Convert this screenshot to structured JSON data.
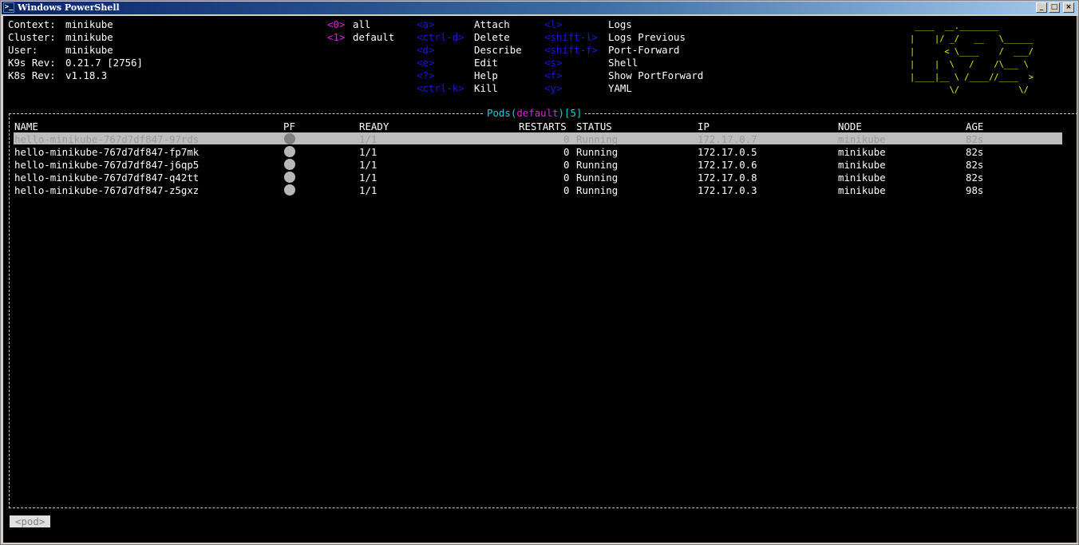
{
  "window": {
    "title": "Windows PowerShell",
    "icon": "powershell-icon",
    "controls": {
      "minimize": "_",
      "maximize": "□",
      "close": "×"
    }
  },
  "info": [
    {
      "label": "Context:",
      "value": "minikube"
    },
    {
      "label": "Cluster:",
      "value": "minikube"
    },
    {
      "label": "User:",
      "value": "minikube"
    },
    {
      "label": "K9s Rev:",
      "value": "0.21.7 [2756]"
    },
    {
      "label": "K8s Rev:",
      "value": "v1.18.3"
    }
  ],
  "namespaces": [
    {
      "key": "<0>",
      "label": "all"
    },
    {
      "key": "<1>",
      "label": "default"
    }
  ],
  "shortcuts_col1": [
    {
      "key": "<a>",
      "label": "Attach"
    },
    {
      "key": "<ctrl-d>",
      "label": "Delete"
    },
    {
      "key": "<d>",
      "label": "Describe"
    },
    {
      "key": "<e>",
      "label": "Edit"
    },
    {
      "key": "<?>",
      "label": "Help"
    },
    {
      "key": "<ctrl-k>",
      "label": "Kill"
    }
  ],
  "shortcuts_col2": [
    {
      "key": "<l>",
      "label": "Logs"
    },
    {
      "key": "<shift-l>",
      "label": "Logs Previous"
    },
    {
      "key": "<shift-f>",
      "label": "Port-Forward"
    },
    {
      "key": "<s>",
      "label": "Shell"
    },
    {
      "key": "<f>",
      "label": "Show PortForward"
    },
    {
      "key": "<y>",
      "label": "YAML"
    }
  ],
  "logo": [
    " ____  __.________       ",
    "|    |/ _/   __   \\______",
    "|      < \\____    /  ___/",
    "|    |  \\   /    /\\___ \\ ",
    "|____|__ \\ /____//____  >",
    "        \\/            \\/ "
  ],
  "table": {
    "title": {
      "resource": "Pods",
      "open": "(",
      "namespace": "default",
      "close": ")",
      "count": "[5]"
    },
    "columns": [
      "NAME",
      "PF",
      "READY",
      "RESTARTS",
      "STATUS",
      "IP",
      "NODE",
      "AGE"
    ],
    "rows": [
      {
        "name": "hello-minikube-767d7df847-97rds",
        "ready": "1/1",
        "restarts": "0",
        "status": "Running",
        "ip": "172.17.0.7",
        "node": "minikube",
        "age": "82s",
        "selected": true
      },
      {
        "name": "hello-minikube-767d7df847-fp7mk",
        "ready": "1/1",
        "restarts": "0",
        "status": "Running",
        "ip": "172.17.0.5",
        "node": "minikube",
        "age": "82s"
      },
      {
        "name": "hello-minikube-767d7df847-j6qp5",
        "ready": "1/1",
        "restarts": "0",
        "status": "Running",
        "ip": "172.17.0.6",
        "node": "minikube",
        "age": "82s"
      },
      {
        "name": "hello-minikube-767d7df847-q42tt",
        "ready": "1/1",
        "restarts": "0",
        "status": "Running",
        "ip": "172.17.0.8",
        "node": "minikube",
        "age": "82s"
      },
      {
        "name": "hello-minikube-767d7df847-z5gxz",
        "ready": "1/1",
        "restarts": "0",
        "status": "Running",
        "ip": "172.17.0.3",
        "node": "minikube",
        "age": "98s"
      }
    ]
  },
  "breadcrumb": "<pod>",
  "colors": {
    "terminal_bg": "#000000",
    "key_namespace": "#e01ee0",
    "key_shortcut": "#1a1ad8",
    "logo": "#f0f000",
    "table_title": "#00d8d8",
    "selected_row": "#bdbdbd"
  }
}
